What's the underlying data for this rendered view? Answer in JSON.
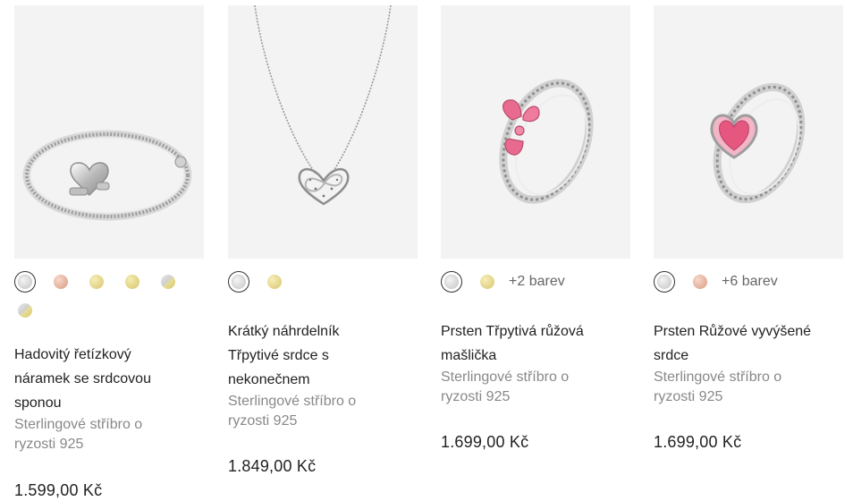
{
  "products": [
    {
      "name": "Hadovitý řetízkový náramek se srdcovou sponou",
      "material": "Sterlingové stříbro o ryzosti 925",
      "price": "1.599,00 Kč",
      "swatches": [
        "silver",
        "rose",
        "gold",
        "gold2",
        "mix",
        "mix"
      ],
      "more": "",
      "image": "heart-clasp-bracelet"
    },
    {
      "name": "Krátký náhrdelník Třpytivé srdce s nekonečnem",
      "material": "Sterlingové stříbro o ryzosti 925",
      "price": "1.849,00 Kč",
      "swatches": [
        "silver",
        "gold"
      ],
      "more": "",
      "image": "infinity-heart-necklace"
    },
    {
      "name": "Prsten Třpytivá růžová mašlička",
      "material": "Sterlingové stříbro o ryzosti 925",
      "price": "1.699,00 Kč",
      "swatches": [
        "silver",
        "gold"
      ],
      "more": "+2 barev",
      "image": "pink-bow-ring"
    },
    {
      "name": "Prsten Růžové vyvýšené srdce",
      "material": "Sterlingové stříbro o ryzosti 925",
      "price": "1.699,00 Kč",
      "swatches": [
        "silver",
        "rose"
      ],
      "more": "+6 barev",
      "image": "pink-heart-halo-ring"
    }
  ]
}
